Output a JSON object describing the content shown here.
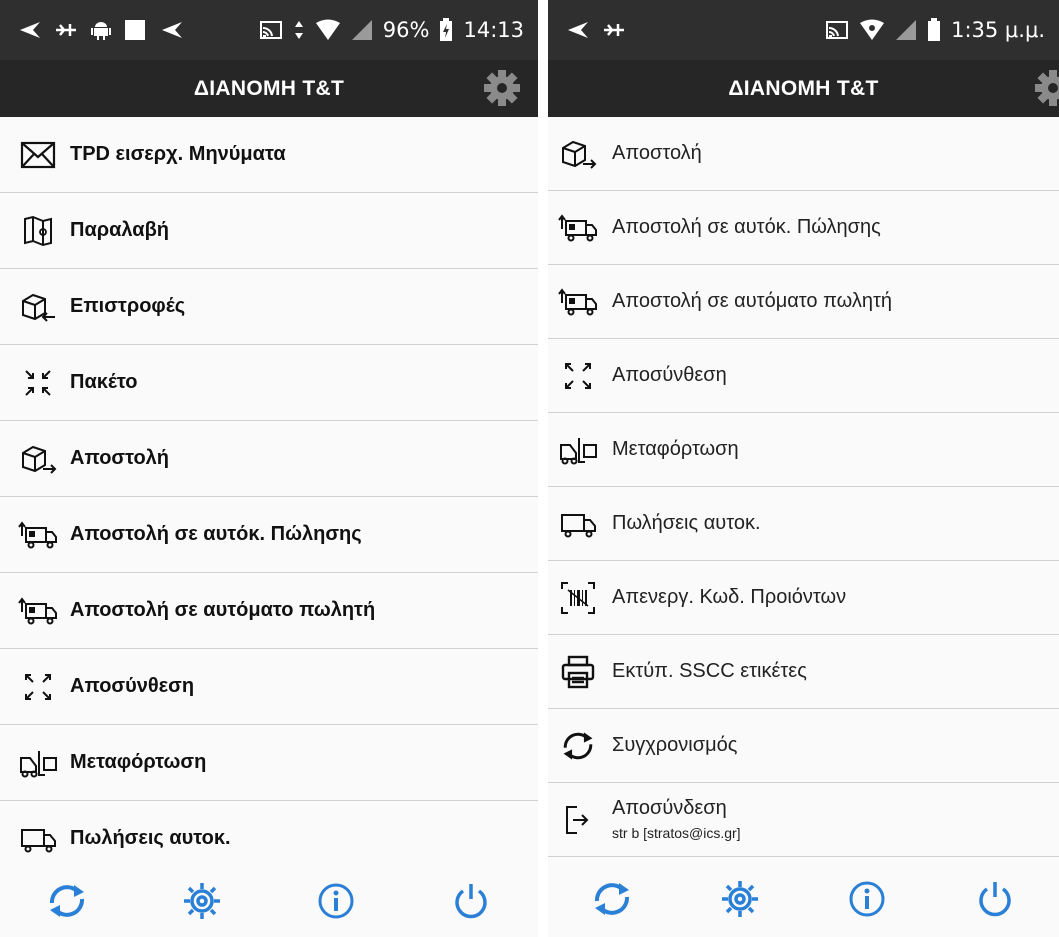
{
  "colors": {
    "accent": "#2a7fd6",
    "statusbar": "#2f2f2f",
    "appbar": "#262626",
    "divider": "#d2d2d2"
  },
  "left": {
    "status": {
      "battery": "96%",
      "time": "14:13"
    },
    "title": "ΔΙΑΝΟΜΗ Τ&Τ",
    "items": [
      {
        "label": "TPD εισερχ. Μηνύματα",
        "icon": "envelope-icon"
      },
      {
        "label": "Παραλαβή",
        "icon": "map-icon"
      },
      {
        "label": "Επιστροφές",
        "icon": "box-return-icon"
      },
      {
        "label": "Πακέτο",
        "icon": "collapse-arrows-icon"
      },
      {
        "label": "Αποστολή",
        "icon": "box-send-icon"
      },
      {
        "label": "Αποστολή σε αυτόκ. Πώλησης",
        "icon": "truck-upload-icon"
      },
      {
        "label": "Αποστολή σε αυτόματο πωλητή",
        "icon": "truck-upload-icon"
      },
      {
        "label": "Αποσύνθεση",
        "icon": "expand-arrows-icon"
      },
      {
        "label": "Μεταφόρτωση",
        "icon": "forklift-icon"
      },
      {
        "label": "Πωλήσεις αυτοκ.",
        "icon": "truck-icon"
      }
    ]
  },
  "right": {
    "status": {
      "time": "1:35 μ.μ."
    },
    "title": "ΔΙΑΝΟΜΗ Τ&Τ",
    "items": [
      {
        "label": "Αποστολή",
        "icon": "box-send-icon"
      },
      {
        "label": "Αποστολή σε αυτόκ. Πώλησης",
        "icon": "truck-upload-icon"
      },
      {
        "label": "Αποστολή σε αυτόματο πωλητή",
        "icon": "truck-upload-icon"
      },
      {
        "label": "Αποσύνθεση",
        "icon": "expand-arrows-icon"
      },
      {
        "label": "Μεταφόρτωση",
        "icon": "forklift-icon"
      },
      {
        "label": "Πωλήσεις αυτοκ.",
        "icon": "truck-icon"
      },
      {
        "label": "Απενεργ. Κωδ. Προιόντων",
        "icon": "barcode-scan-icon"
      },
      {
        "label": "Εκτύπ. SSCC ετικέτες",
        "icon": "printer-icon"
      },
      {
        "label": "Συγχρονισμός",
        "icon": "sync-icon"
      },
      {
        "label": "Αποσύνδεση",
        "sub": "str b [stratos@ics.gr]",
        "icon": "logout-icon"
      }
    ]
  },
  "bottom": [
    "sync-icon",
    "settings-icon",
    "info-icon",
    "power-icon"
  ]
}
